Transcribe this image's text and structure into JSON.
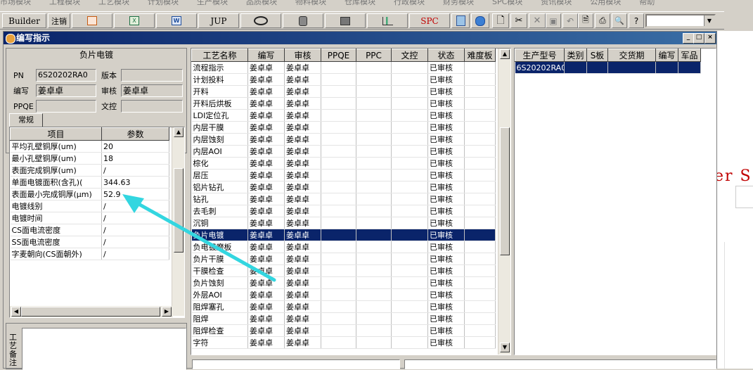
{
  "menu": [
    "市场模块",
    "工程模块",
    "工艺模块",
    "计划模块",
    "生产模块",
    "品质模块",
    "物料模块",
    "仓库模块",
    "行政模块",
    "财务模块",
    "SPC模块",
    "资讯模块",
    "公用模块",
    "帮助"
  ],
  "toolbar": {
    "builder_label": "Builder",
    "logout_label": "注销",
    "jup_label": "JUP",
    "spc_label": "SPC",
    "combo_value": ""
  },
  "window": {
    "title": "编写指示"
  },
  "left": {
    "section_title": "负片电镀",
    "pn_label": "PN",
    "pn_value": "6S20202RA0",
    "version_label": "版本",
    "version_value": "",
    "writer_label": "编写",
    "writer_value": "姜卓卓",
    "audit_label": "审核",
    "audit_value": "姜卓卓",
    "ppqe_label": "PPQE",
    "ppqe_value": "",
    "wenkong_label": "文控",
    "wenkong_value": "",
    "tab_label": "常规",
    "param_headers": [
      "项目",
      "参数"
    ],
    "params": [
      {
        "item": "平均孔壁铜厚(um)",
        "value": "20"
      },
      {
        "item": "最小孔壁铜厚(um)",
        "value": "18"
      },
      {
        "item": "表面完成铜厚(um)",
        "value": "/"
      },
      {
        "item": "单面电镀面积(含孔)(",
        "value": "344.63"
      },
      {
        "item": "表面最小完成铜厚(μm)",
        "value": "52.9"
      },
      {
        "item": "电镀线别",
        "value": "/"
      },
      {
        "item": "电镀时间",
        "value": "/"
      },
      {
        "item": "CS面电流密度",
        "value": "/"
      },
      {
        "item": "SS面电流密度",
        "value": "/"
      },
      {
        "item": "字麦朝向(CS面朝外)",
        "value": "/"
      }
    ],
    "notes_label": "工艺备注"
  },
  "process": {
    "headers": [
      "工艺名称",
      "编写",
      "审核",
      "PPQE",
      "PPC",
      "文控",
      "状态",
      "难度板"
    ],
    "selected_index": 15,
    "rows": [
      {
        "name": "流程指示",
        "writer": "姜卓卓",
        "auditor": "姜卓卓",
        "status": "已审核"
      },
      {
        "name": "计划投料",
        "writer": "姜卓卓",
        "auditor": "姜卓卓",
        "status": "已审核"
      },
      {
        "name": "开料",
        "writer": "姜卓卓",
        "auditor": "姜卓卓",
        "status": "已审核"
      },
      {
        "name": "开料后烘板",
        "writer": "姜卓卓",
        "auditor": "姜卓卓",
        "status": "已审核"
      },
      {
        "name": "LDI定位孔",
        "writer": "姜卓卓",
        "auditor": "姜卓卓",
        "status": "已审核"
      },
      {
        "name": "内层干膜",
        "writer": "姜卓卓",
        "auditor": "姜卓卓",
        "status": "已审核"
      },
      {
        "name": "内层蚀刻",
        "writer": "姜卓卓",
        "auditor": "姜卓卓",
        "status": "已审核"
      },
      {
        "name": "内层AOI",
        "writer": "姜卓卓",
        "auditor": "姜卓卓",
        "status": "已审核"
      },
      {
        "name": "棕化",
        "writer": "姜卓卓",
        "auditor": "姜卓卓",
        "status": "已审核"
      },
      {
        "name": "层压",
        "writer": "姜卓卓",
        "auditor": "姜卓卓",
        "status": "已审核"
      },
      {
        "name": "铝片钻孔",
        "writer": "姜卓卓",
        "auditor": "姜卓卓",
        "status": "已审核"
      },
      {
        "name": "钻孔",
        "writer": "姜卓卓",
        "auditor": "姜卓卓",
        "status": "已审核"
      },
      {
        "name": "去毛刺",
        "writer": "姜卓卓",
        "auditor": "姜卓卓",
        "status": "已审核"
      },
      {
        "name": "沉铜",
        "writer": "姜卓卓",
        "auditor": "姜卓卓",
        "status": "已审核"
      },
      {
        "name": "负片电镀",
        "writer": "姜卓卓",
        "auditor": "姜卓卓",
        "status": "已审核"
      },
      {
        "name": "负电镀磨板",
        "writer": "姜卓卓",
        "auditor": "姜卓卓",
        "status": "已审核"
      },
      {
        "name": "负片干膜",
        "writer": "姜卓卓",
        "auditor": "姜卓卓",
        "status": "已审核"
      },
      {
        "name": "干膜检查",
        "writer": "姜卓卓",
        "auditor": "姜卓卓",
        "status": "已审核"
      },
      {
        "name": "负片蚀刻",
        "writer": "姜卓卓",
        "auditor": "姜卓卓",
        "status": "已审核"
      },
      {
        "name": "外层AOI",
        "writer": "姜卓卓",
        "auditor": "姜卓卓",
        "status": "已审核"
      },
      {
        "name": "阻焊塞孔",
        "writer": "姜卓卓",
        "auditor": "姜卓卓",
        "status": "已审核"
      },
      {
        "name": "阻焊",
        "writer": "姜卓卓",
        "auditor": "姜卓卓",
        "status": "已审核"
      },
      {
        "name": "阻焊检查",
        "writer": "姜卓卓",
        "auditor": "姜卓卓",
        "status": "已审核"
      },
      {
        "name": "字符",
        "writer": "姜卓卓",
        "auditor": "姜卓卓",
        "status": "已审核"
      }
    ]
  },
  "product": {
    "headers": [
      "生产型号",
      "类别",
      "S板",
      "交货期",
      "编写",
      "军品"
    ],
    "rows": [
      {
        "model": "6S20202RA0"
      }
    ]
  },
  "background_text": "er S",
  "annotation_color": "#33d6e0"
}
